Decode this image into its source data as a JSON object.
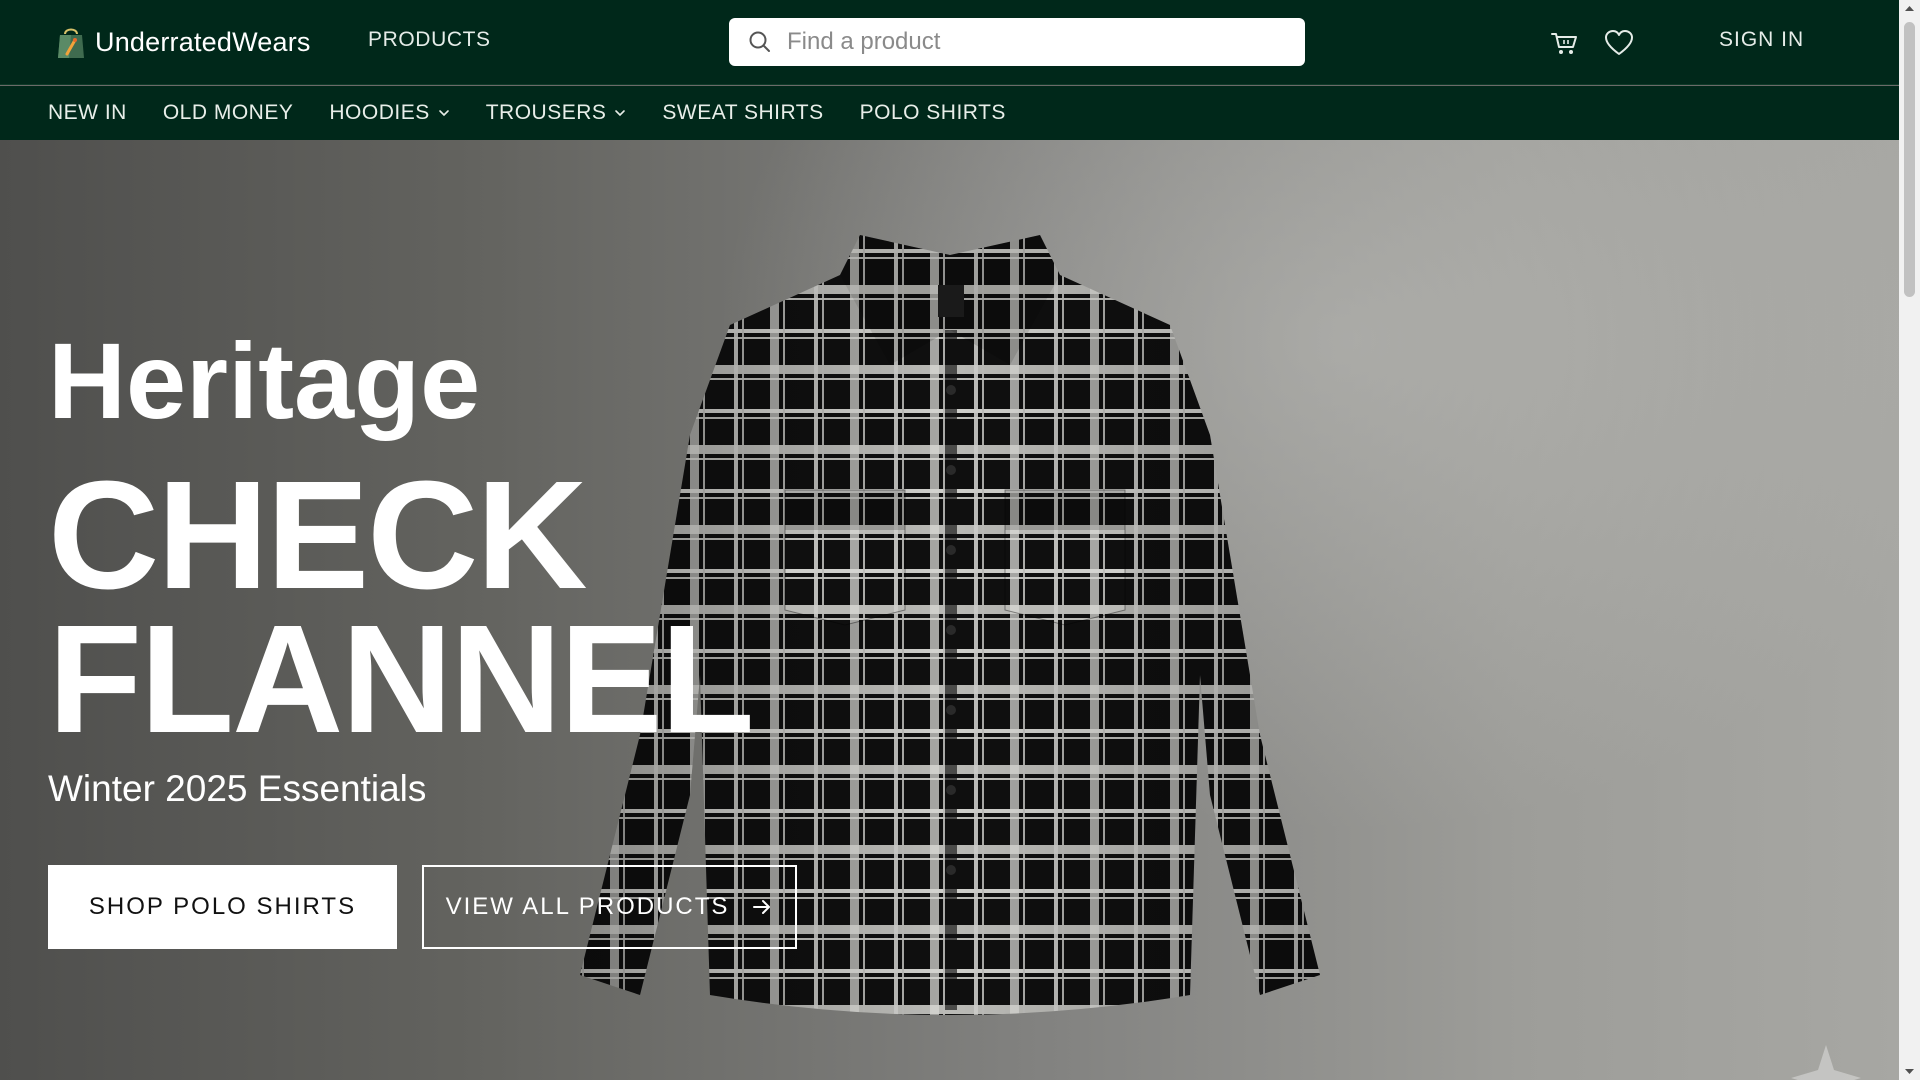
{
  "brand": {
    "name": "UnderratedWears",
    "accent": "#00281a"
  },
  "header": {
    "products_label": "PRODUCTS",
    "search": {
      "placeholder": "Find a product",
      "value": ""
    },
    "icons": {
      "search": "search-icon",
      "cart": "cart-icon",
      "wishlist": "heart-icon"
    },
    "signin_label": "SIGN IN"
  },
  "nav": {
    "items": [
      {
        "label": "NEW IN"
      },
      {
        "label": "OLD MONEY"
      },
      {
        "label": "HOODIES",
        "has_dropdown": true
      },
      {
        "label": "TROUSERS",
        "has_dropdown": true
      },
      {
        "label": "SWEAT SHIRTS"
      },
      {
        "label": "POLO SHIRTS"
      }
    ]
  },
  "hero": {
    "kicker": "Heritage",
    "headline_1": "CHECK",
    "headline_2": "FLANNEL",
    "subtitle": "Winter 2025 Essentials",
    "primary_cta": "SHOP POLO SHIRTS",
    "secondary_cta": "VIEW ALL PRODUCTS",
    "image": "black-white-check-flannel-shirt",
    "colors": {
      "text": "#ffffff",
      "shirt_dark": "#111111",
      "shirt_light": "#d8d8d4"
    }
  }
}
